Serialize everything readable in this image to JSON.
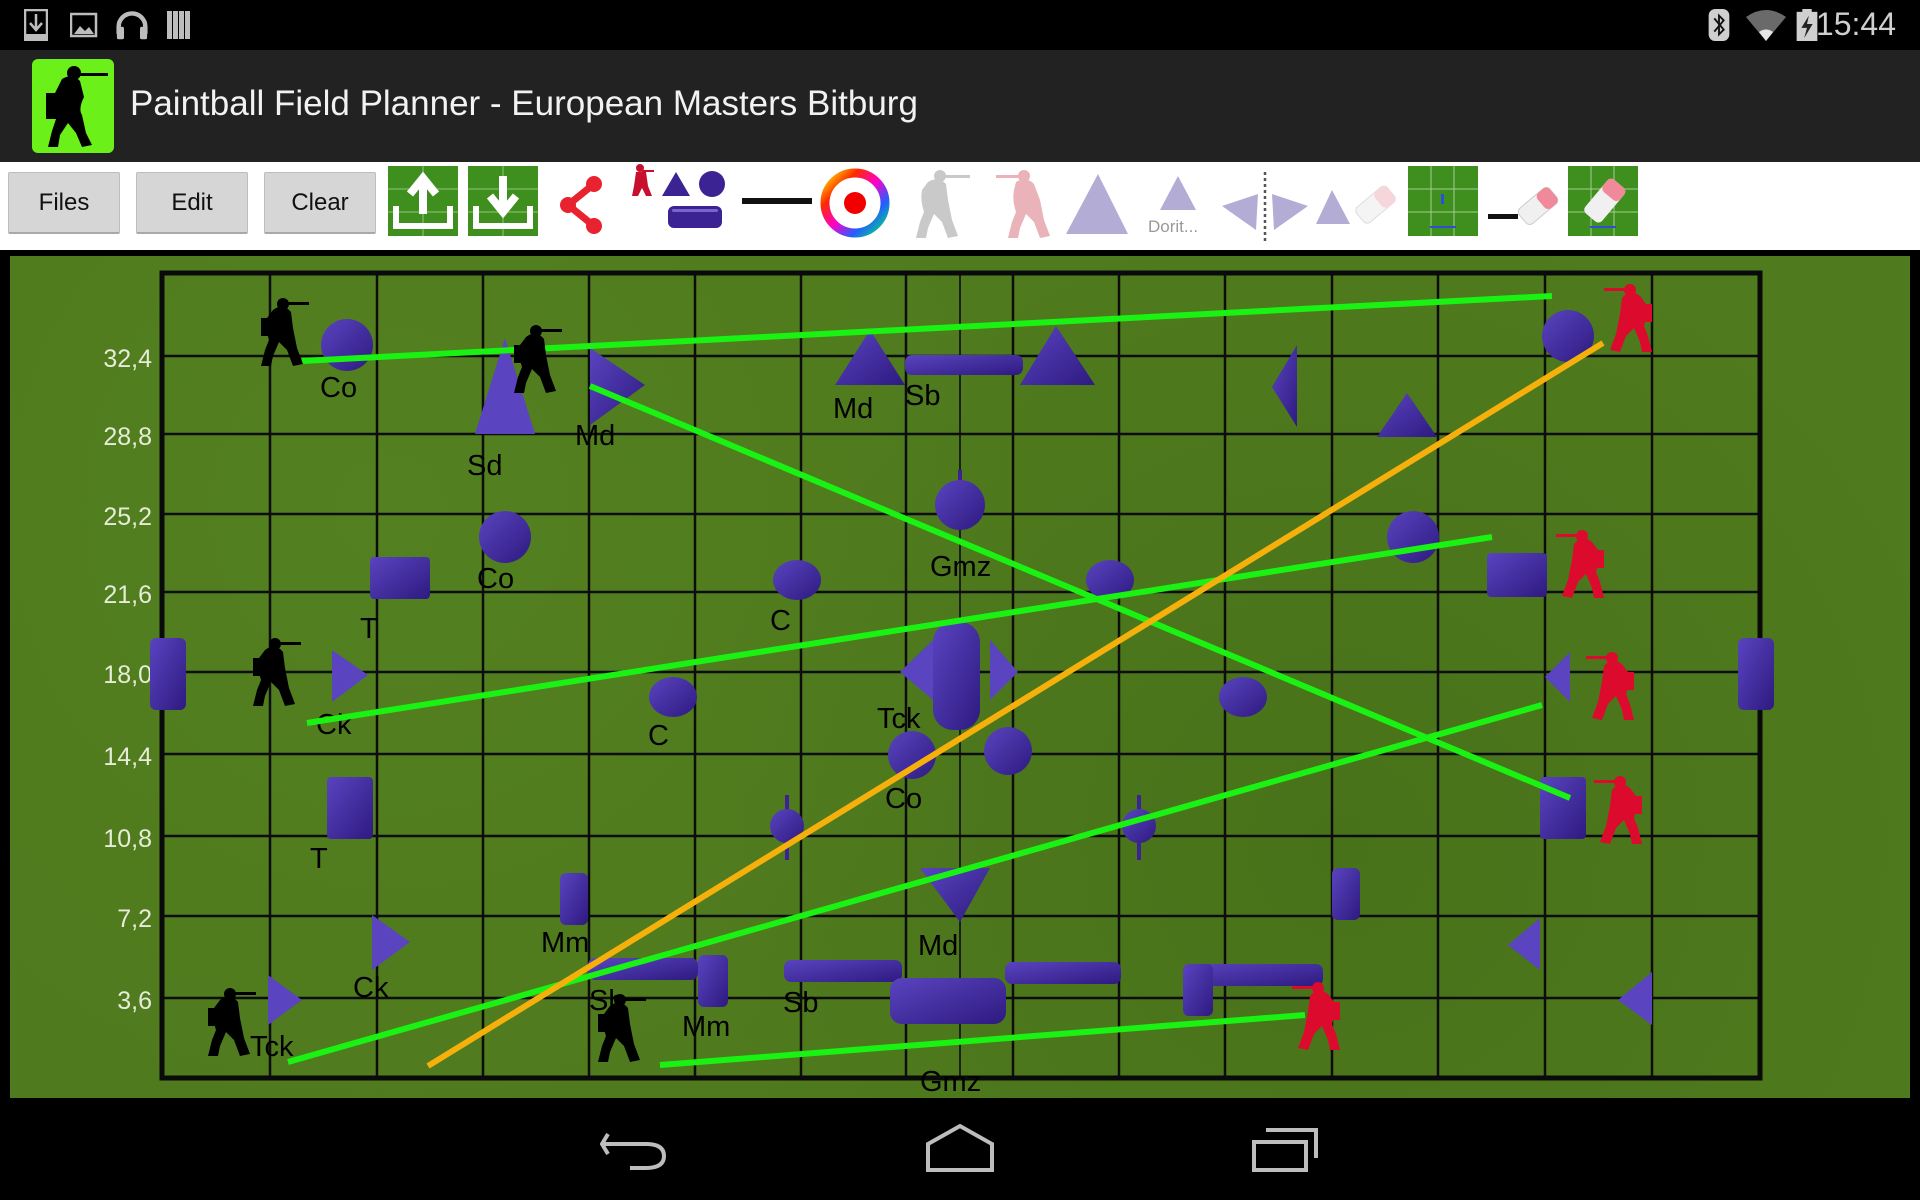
{
  "status_bar": {
    "left_icons": [
      "download-icon",
      "gallery-icon",
      "headphones-icon",
      "play-books-icon"
    ],
    "right_icons": [
      "bluetooth-icon",
      "wifi-icon",
      "battery-charging-icon"
    ],
    "time": "15:44"
  },
  "action_bar": {
    "app_icon": "paintball-player-icon",
    "title": "Paintball Field Planner - European Masters Bitburg"
  },
  "toolbar": {
    "buttons": [
      {
        "label": "Files"
      },
      {
        "label": "Edit"
      },
      {
        "label": "Clear"
      }
    ],
    "icons": [
      {
        "name": "upload-field-icon"
      },
      {
        "name": "download-field-icon"
      },
      {
        "name": "share-icon"
      },
      {
        "name": "add-objects-icon"
      },
      {
        "name": "line-tool-icon"
      },
      {
        "name": "color-picker-icon"
      },
      {
        "name": "black-player-icon"
      },
      {
        "name": "red-player-icon"
      },
      {
        "name": "large-triangle-icon"
      },
      {
        "name": "dorito-icon",
        "label": "Dorit..."
      },
      {
        "name": "mirror-icon"
      },
      {
        "name": "erase-object-icon"
      },
      {
        "name": "field-view-icon"
      },
      {
        "name": "erase-line-icon"
      },
      {
        "name": "erase-field-icon"
      }
    ],
    "colors": {
      "accent_red": "#e8222e",
      "bunker_purple": "#3b2394",
      "toolbar_bg": "#ffffff"
    }
  },
  "field": {
    "y_axis_labels": [
      "32,4",
      "28,8",
      "25,2",
      "21,6",
      "18,0",
      "14,4",
      "10,8",
      "7,2",
      "3,6"
    ],
    "colors": {
      "grass": "#4f7a1d",
      "grid": "#0d0d0d",
      "bunker": "#3b2394",
      "bunker_highlight": "#7a63cc",
      "lane_green": "#19f213",
      "lane_orange": "#f5b00b",
      "team_black": "#000000",
      "team_red": "#dc0a2c"
    },
    "labels": [
      {
        "text": "Co"
      },
      {
        "text": "Md"
      },
      {
        "text": "Sd"
      },
      {
        "text": "Md"
      },
      {
        "text": "Sb"
      },
      {
        "text": "Co"
      },
      {
        "text": "Gmz"
      },
      {
        "text": "T"
      },
      {
        "text": "C"
      },
      {
        "text": "Ck"
      },
      {
        "text": "C"
      },
      {
        "text": "Tck"
      },
      {
        "text": "Co"
      },
      {
        "text": "T"
      },
      {
        "text": "Mm"
      },
      {
        "text": "Md"
      },
      {
        "text": "Ck"
      },
      {
        "text": "Sb"
      },
      {
        "text": "Sb"
      },
      {
        "text": "Mm"
      },
      {
        "text": "Tck"
      },
      {
        "text": "Gmz"
      }
    ]
  },
  "nav_bar": {
    "buttons": [
      "back-icon",
      "home-icon",
      "recent-apps-icon"
    ]
  }
}
